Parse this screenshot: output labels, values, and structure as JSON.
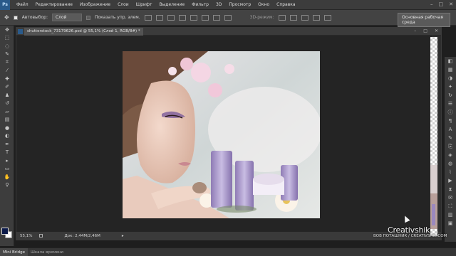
{
  "app": {
    "logo_text": "Ps",
    "menu": [
      "Файл",
      "Редактирование",
      "Изображение",
      "Слои",
      "Шрифт",
      "Выделение",
      "Фильтр",
      "3D",
      "Просмотр",
      "Окно",
      "Справка"
    ],
    "window_controls": [
      "–",
      "□",
      "✕"
    ]
  },
  "options_bar": {
    "autoselect_label": "Автовыбор:",
    "autoselect_value": "Слой",
    "show_controls_label": "Показать упр. элем.",
    "mode_3d_label": "3D-режим:",
    "workspace_value": "Основная рабочая среда"
  },
  "toolbox": {
    "tools": [
      "move-tool",
      "marquee-tool",
      "lasso-tool",
      "quick-select-tool",
      "crop-tool",
      "eyedropper-tool",
      "healing-tool",
      "brush-tool",
      "stamp-tool",
      "history-brush-tool",
      "eraser-tool",
      "gradient-tool",
      "blur-tool",
      "dodge-tool",
      "pen-tool",
      "type-tool",
      "path-select-tool",
      "shape-tool",
      "hand-tool",
      "zoom-tool"
    ],
    "colors": {
      "foreground": "#0d1b4a",
      "background": "#ffffff"
    }
  },
  "document": {
    "tab_title": "shutterstock_73179626.psd @ 55,1% (Слой 1, RGB/8#) *",
    "zoom": "55,1%",
    "doc_size": "Док: 2,44M/2,46M",
    "controls": [
      "–",
      "□",
      "✕"
    ]
  },
  "bottom_tabs": [
    "Mini Bridge",
    "Шкала времени"
  ],
  "watermark": {
    "brand": "Creativshik",
    "credit": "ВОВ ПОТАШНИК / CREATIVSHIK.COM"
  },
  "colors": {
    "accent": "#2a5a8a",
    "ui_dark": "#262626",
    "ui_panel": "#3c3c3c"
  }
}
